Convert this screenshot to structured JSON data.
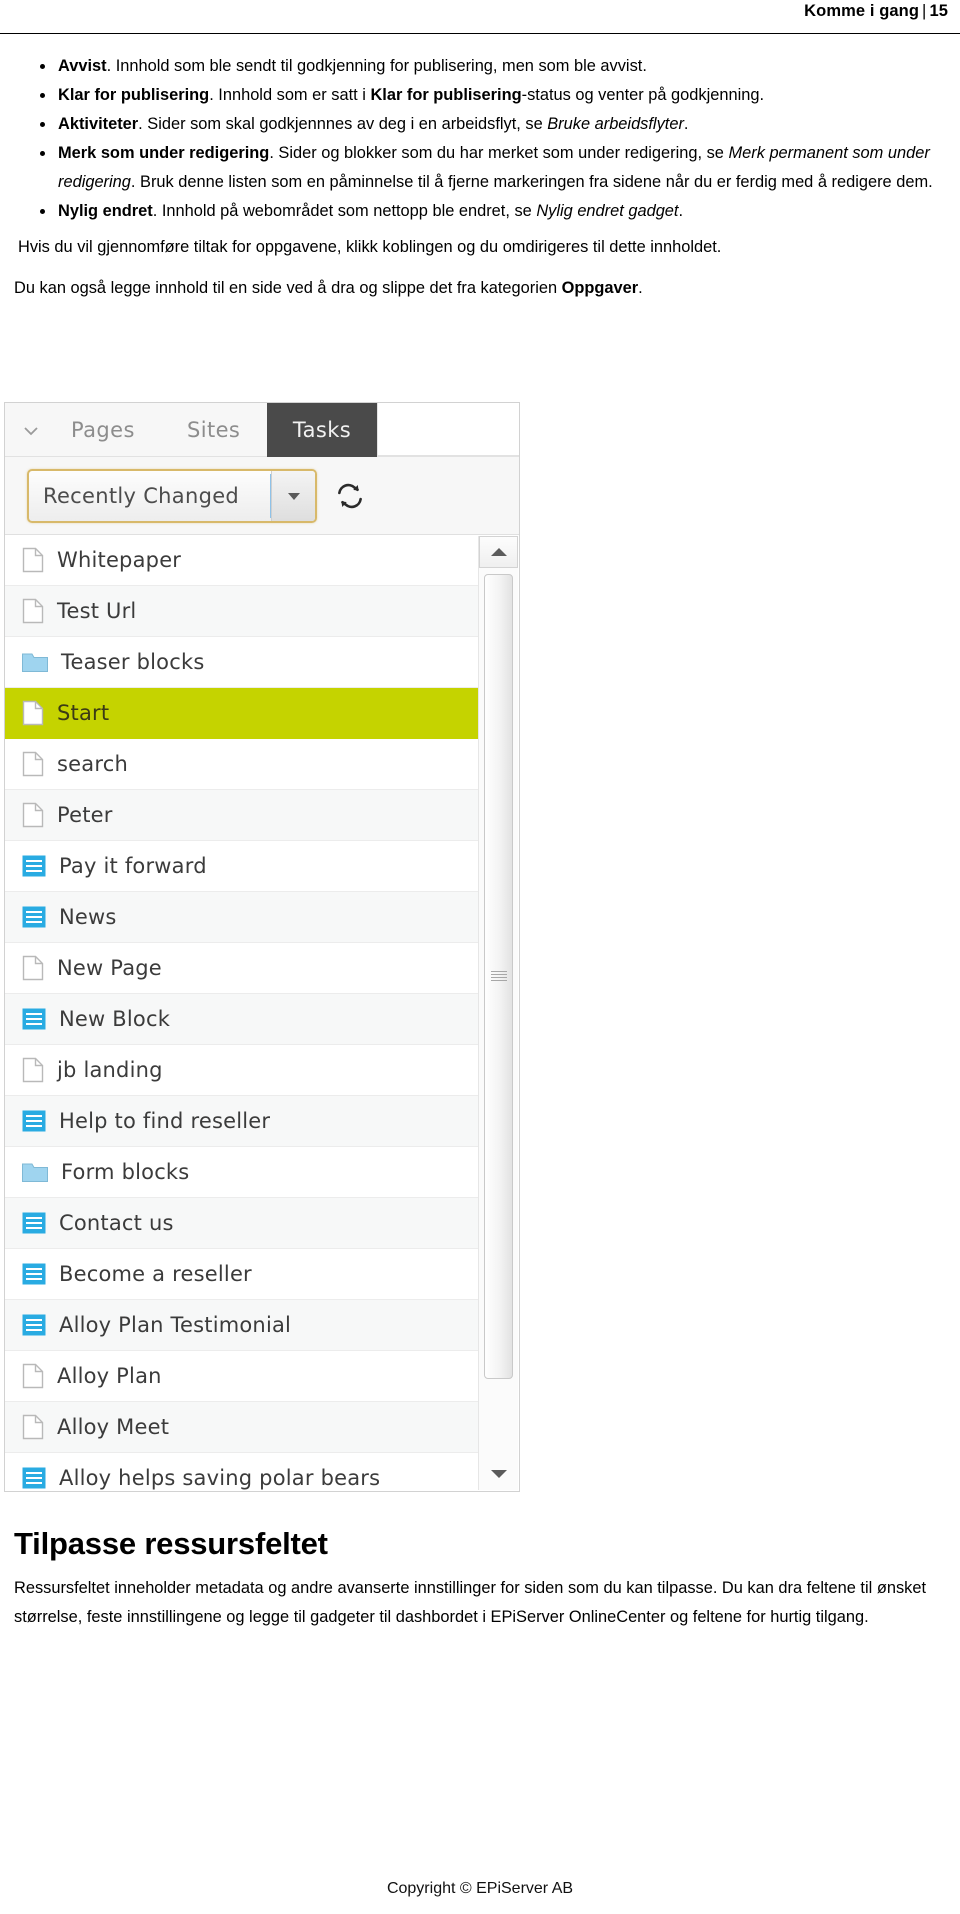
{
  "header": {
    "title": "Komme i gang",
    "separator": "|",
    "page_number": "15"
  },
  "body": {
    "bullets": [
      {
        "term": "Avvist",
        "rest": ". Innhold som ble sendt til godkjenning for publisering, men som ble avvist."
      },
      {
        "term": "Klar for publisering",
        "rest": ". Innhold som er satt i ",
        "emph_bold": "Klar for publisering",
        "rest2": "-status og venter på godkjenning."
      },
      {
        "term": "Aktiviteter",
        "rest": ". Sider som skal godkjennnes av deg i en arbeidsflyt, se ",
        "emph_italic": "Bruke arbeidsflyter",
        "rest2": "."
      },
      {
        "term": "Merk som under redigering",
        "rest": ". Sider og blokker som du har merket som under redigering, se ",
        "emph_italic": "Merk permanent som under redigering",
        "rest2": ". Bruk denne listen som en påminnelse til å fjerne markeringen fra sidene når du er ferdig med å redigere dem."
      },
      {
        "term": "Nylig endret",
        "rest": ". Innhold på webområdet som nettopp ble endret, se ",
        "emph_italic": "Nylig endret gadget",
        "rest2": "."
      }
    ],
    "paragraph_1": "Hvis du vil gjennomføre tiltak for oppgavene, klikk koblingen og du omdirigeres til dette innholdet.",
    "paragraph_2_pre": "Du kan også legge innhold til en side ved å dra og slippe det fra kategorien ",
    "paragraph_2_bold": "Oppgaver",
    "paragraph_2_post": "."
  },
  "screenshot": {
    "collapse_icon": "chevron-down-icon",
    "tabs": [
      {
        "label": "Pages",
        "active": false
      },
      {
        "label": "Sites",
        "active": false
      },
      {
        "label": "Tasks",
        "active": true
      }
    ],
    "filter_select": {
      "value": "Recently Changed",
      "arrow_icon": "chevron-down-icon"
    },
    "refresh_icon": "refresh-icon",
    "scrollbar": {
      "up_icon": "scroll-up-arrow-icon",
      "down_icon": "scroll-down-arrow-icon",
      "grip_icon": "scrollbar-grip-icon"
    },
    "selected_accent": "#c5d300",
    "block_icon_color": "#29abe2",
    "folder_icon_color": "#9fd4ef",
    "items": [
      {
        "label": "Whitepaper",
        "type": "page",
        "selected": false
      },
      {
        "label": "Test Url",
        "type": "page",
        "selected": false
      },
      {
        "label": "Teaser blocks",
        "type": "folder",
        "selected": false
      },
      {
        "label": "Start",
        "type": "page",
        "selected": true
      },
      {
        "label": "search",
        "type": "page",
        "selected": false
      },
      {
        "label": "Peter",
        "type": "page",
        "selected": false
      },
      {
        "label": "Pay it forward",
        "type": "block",
        "selected": false
      },
      {
        "label": "News",
        "type": "block",
        "selected": false
      },
      {
        "label": "New Page",
        "type": "page",
        "selected": false
      },
      {
        "label": "New Block",
        "type": "block",
        "selected": false
      },
      {
        "label": "jb landing",
        "type": "page",
        "selected": false
      },
      {
        "label": "Help to find reseller",
        "type": "block",
        "selected": false
      },
      {
        "label": "Form blocks",
        "type": "folder",
        "selected": false
      },
      {
        "label": "Contact us",
        "type": "block",
        "selected": false
      },
      {
        "label": "Become a reseller",
        "type": "block",
        "selected": false
      },
      {
        "label": "Alloy Plan Testimonial",
        "type": "block",
        "selected": false
      },
      {
        "label": "Alloy Plan",
        "type": "page",
        "selected": false
      },
      {
        "label": "Alloy Meet",
        "type": "page",
        "selected": false
      },
      {
        "label": "Alloy helps saving polar bears",
        "type": "block",
        "selected": false
      }
    ]
  },
  "section": {
    "title": "Tilpasse ressursfeltet",
    "paragraph": "Ressursfeltet inneholder metadata og andre avanserte innstillinger for siden som du kan tilpasse. Du kan dra feltene til ønsket størrelse, feste innstillingene og legge til gadgeter til dashbordet i EPiServer OnlineCenter og feltene for hurtig tilgang."
  },
  "footer": {
    "text": "Copyright © EPiServer AB"
  }
}
